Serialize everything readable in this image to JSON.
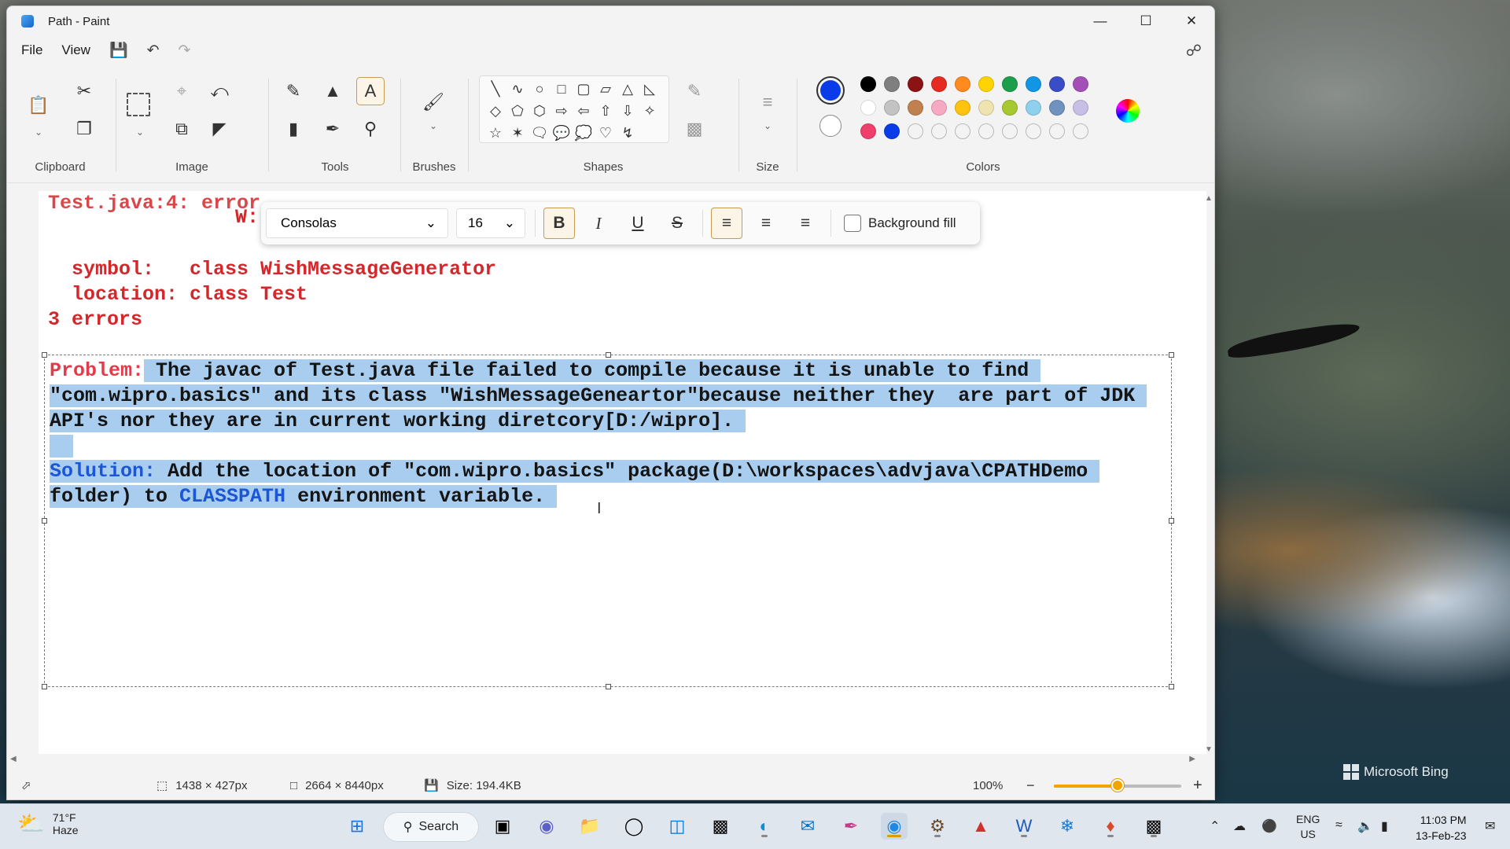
{
  "window": {
    "title": "Path - Paint"
  },
  "menu": {
    "file": "File",
    "view": "View"
  },
  "ribbon": {
    "groups": {
      "clipboard": "Clipboard",
      "image": "Image",
      "tools": "Tools",
      "brushes": "Brushes",
      "shapes": "Shapes",
      "size": "Size",
      "colors": "Colors"
    },
    "primary_color": "#0a3be8",
    "secondary_color": "#ffffff",
    "palette": [
      "#000000",
      "#7f7f7f",
      "#8b1313",
      "#e52b22",
      "#ff8a1e",
      "#ffd400",
      "#1c9e4a",
      "#1196e5",
      "#3a4dc8",
      "#a44fb8",
      "#ffffff",
      "#c3c3c3",
      "#c08050",
      "#f7a9c4",
      "#ffc20e",
      "#efe4b0",
      "#a8c832",
      "#8ed0ee",
      "#7092be",
      "#c8bfe7",
      "#ef3f6a",
      "#0a3be8",
      "",
      "",
      "",
      "",
      "",
      "",
      "",
      ""
    ]
  },
  "format_bar": {
    "font": "Consolas",
    "size": "16",
    "bold": "B",
    "italic": "I",
    "underline": "U",
    "strike": "S",
    "background_fill": "Background fill"
  },
  "canvas": {
    "line0": "Test.java:4: error",
    "line1": "W:",
    "line2": "  symbol:   class WishMessageGenerator",
    "line3": "  location: class Test",
    "line4": "3 errors",
    "problem_label": "Problem:",
    "problem_l1": " The javac of Test.java file failed to compile because it is unable to find ",
    "problem_l2": "\"com.wipro.basics\" and its class \"WishMessageGeneartor\"because neither they  are part of JDK ",
    "problem_l3": "API's nor they are in current working diretcory[D:/wipro]. ",
    "blank": "  ",
    "solution_label": "Solution:",
    "solution_l1": " Add the location of \"com.wipro.basics\" package(D:\\workspaces\\advjava\\CPATHDemo ",
    "solution_l2a": "folder) to ",
    "solution_classpath": "CLASSPATH",
    "solution_l2b": " environment variable. "
  },
  "status": {
    "selection": "1438 × 427px",
    "canvas_size": "2664 × 8440px",
    "file_size": "Size: 194.4KB",
    "zoom": "100%",
    "zoom_level": 0.5
  },
  "desktop": {
    "bing": "Microsoft Bing"
  },
  "taskbar": {
    "temp": "71°F",
    "weather": "Haze",
    "search": "Search",
    "lang1": "ENG",
    "lang2": "US",
    "time": "11:03 PM",
    "date": "13-Feb-23"
  }
}
